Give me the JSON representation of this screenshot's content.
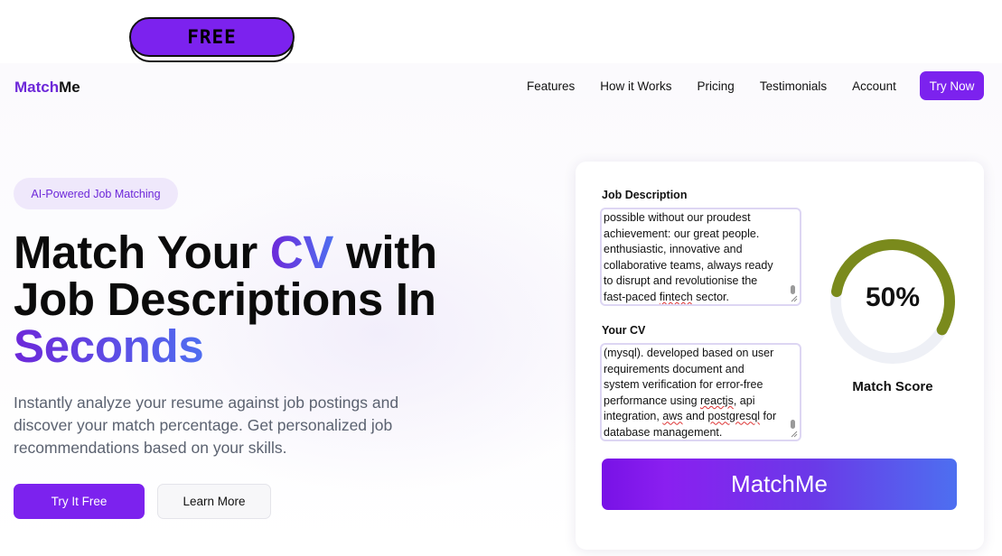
{
  "sticker": {
    "label": "FREE"
  },
  "nav": {
    "logo_part1": "Match",
    "logo_part2": "Me",
    "links": [
      "Features",
      "How it Works",
      "Pricing",
      "Testimonials",
      "Account"
    ],
    "cta": "Try Now"
  },
  "hero": {
    "tag": "AI-Powered Job Matching",
    "headline_line1_pre": "Match Your ",
    "headline_line1_accent": "CV",
    "headline_line1_post": " with",
    "headline_line2": "Job Descriptions In",
    "headline_line3": "Seconds",
    "subtext": "Instantly analyze your resume against job postings and discover your match percentage. Get personalized job recommendations based on your skills.",
    "primary_button": "Try It Free",
    "secondary_button": "Learn More"
  },
  "card": {
    "job_label": "Job Description",
    "job_lines": [
      "possible without our proudest",
      "achievement: our great people.",
      "enthusiastic, innovative and",
      "collaborative teams, always ready",
      "to disrupt and revolutionise the",
      "fast-paced fintech sector."
    ],
    "cv_label": "Your CV",
    "cv_lines": [
      "(mysql). developed based on user",
      "requirements document and",
      "system verification for error-free",
      "performance using reactjs, api",
      "integration, aws and postgresql for",
      "database management."
    ],
    "score_value": "50%",
    "score_fraction": 0.5,
    "score_label": "Match Score",
    "action_button": "MatchMe"
  },
  "colors": {
    "brand": "#7c22ee",
    "gauge_fill": "#7a8a1c",
    "gauge_track": "#eef0f6"
  }
}
